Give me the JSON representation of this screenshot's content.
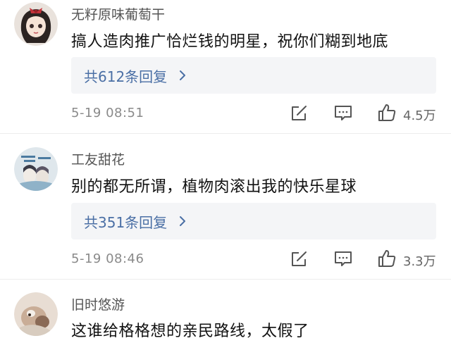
{
  "comments": [
    {
      "username": "无籽原味葡萄干",
      "text": "搞人造肉推广恰烂钱的明星，祝你们糊到地底",
      "replies_label": "共612条回复",
      "time": "5-19 08:51",
      "likes": "4.5万",
      "avatar": "avatar-girl-cartoon"
    },
    {
      "username": "工友甜花",
      "text": "别的都无所谓，植物肉滚出我的快乐星球",
      "replies_label": "共351条回复",
      "time": "5-19 08:46",
      "likes": "3.3万",
      "avatar": "avatar-anime-pair"
    },
    {
      "username": "旧时悠游",
      "text": "这谁给格格想的亲民路线，太假了",
      "avatar": "avatar-pet-photo"
    }
  ],
  "icons": {
    "share": "share-icon",
    "comment": "comment-icon",
    "like": "thumbs-up-icon",
    "chevron": "chevron-right-icon"
  },
  "colors": {
    "link": "#4a6fa5",
    "reply_bg": "#f4f5f7",
    "meta": "#8a8a8a"
  }
}
